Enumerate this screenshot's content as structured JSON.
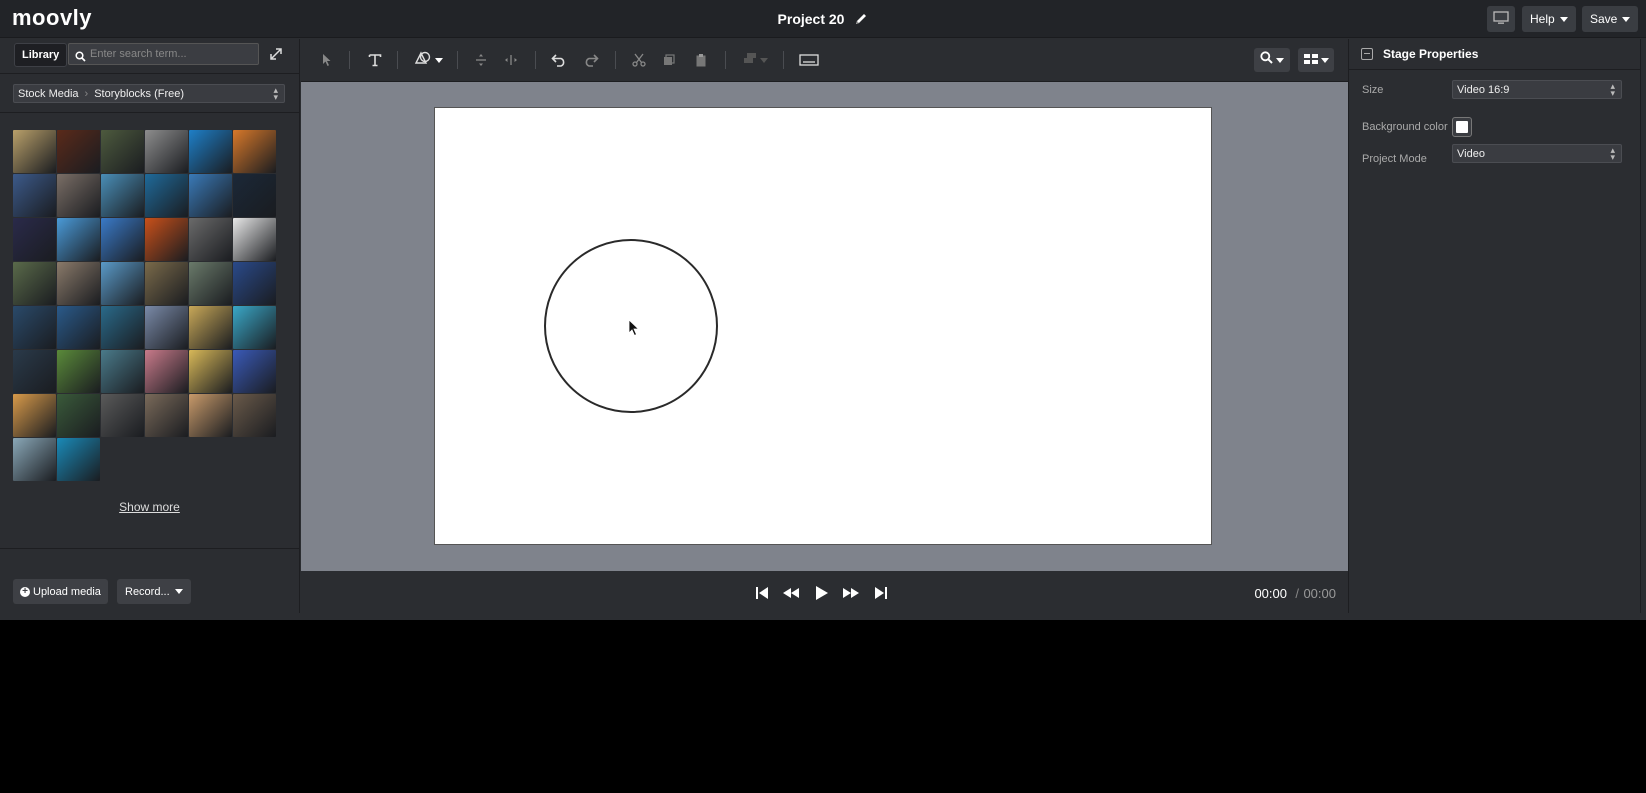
{
  "app": {
    "logo": "moovly",
    "project_title": "Project 20"
  },
  "topbar": {
    "help_label": "Help",
    "save_label": "Save"
  },
  "library": {
    "tab_label": "Library",
    "search": {
      "placeholder": "Enter search term...",
      "value": ""
    },
    "source": {
      "root": "Stock Media",
      "current": "Storyblocks (Free)"
    },
    "show_more_label": "Show more",
    "upload_label": "Upload media",
    "record_label": "Record...",
    "thumbnails": [
      "#b9a06a",
      "#5a2a1a",
      "#4d5a3e",
      "#8d8d8d",
      "#1e7fc8",
      "#d7782a",
      "#3c5a8a",
      "#7a6e66",
      "#4a8fb8",
      "#1f6a9a",
      "#3a7ab8",
      "#1b2838",
      "#2a2a4a",
      "#4a9ad8",
      "#3a7ac8",
      "#c8501a",
      "#6a6a6a",
      "#e8e8e8",
      "#5a6a4a",
      "#8a7a6a",
      "#5a9ac8",
      "#7a6a4a",
      "#6a7a6a",
      "#2a4a8a",
      "#2a4a6a",
      "#2a5a8a",
      "#2a6a8a",
      "#7a8aa8",
      "#c8a858",
      "#3aa8c8",
      "#2a3a4a",
      "#5a8a3a",
      "#4a7a8a",
      "#c87a8a",
      "#d8b858",
      "#3a5ab8",
      "#d89a4a",
      "#3a5a3a",
      "#5a5a5a",
      "#7a6a5a",
      "#c89a6a",
      "#6a5a4a",
      "#8aa8b8",
      "#1a8ab8"
    ]
  },
  "stage_properties": {
    "title": "Stage Properties",
    "size_label": "Size",
    "size_value": "Video 16:9",
    "background_label": "Background color",
    "background_color": "#ffffff",
    "mode_label": "Project Mode",
    "mode_value": "Video"
  },
  "playback": {
    "current": "00:00",
    "separator": "/",
    "total": "00:00"
  }
}
